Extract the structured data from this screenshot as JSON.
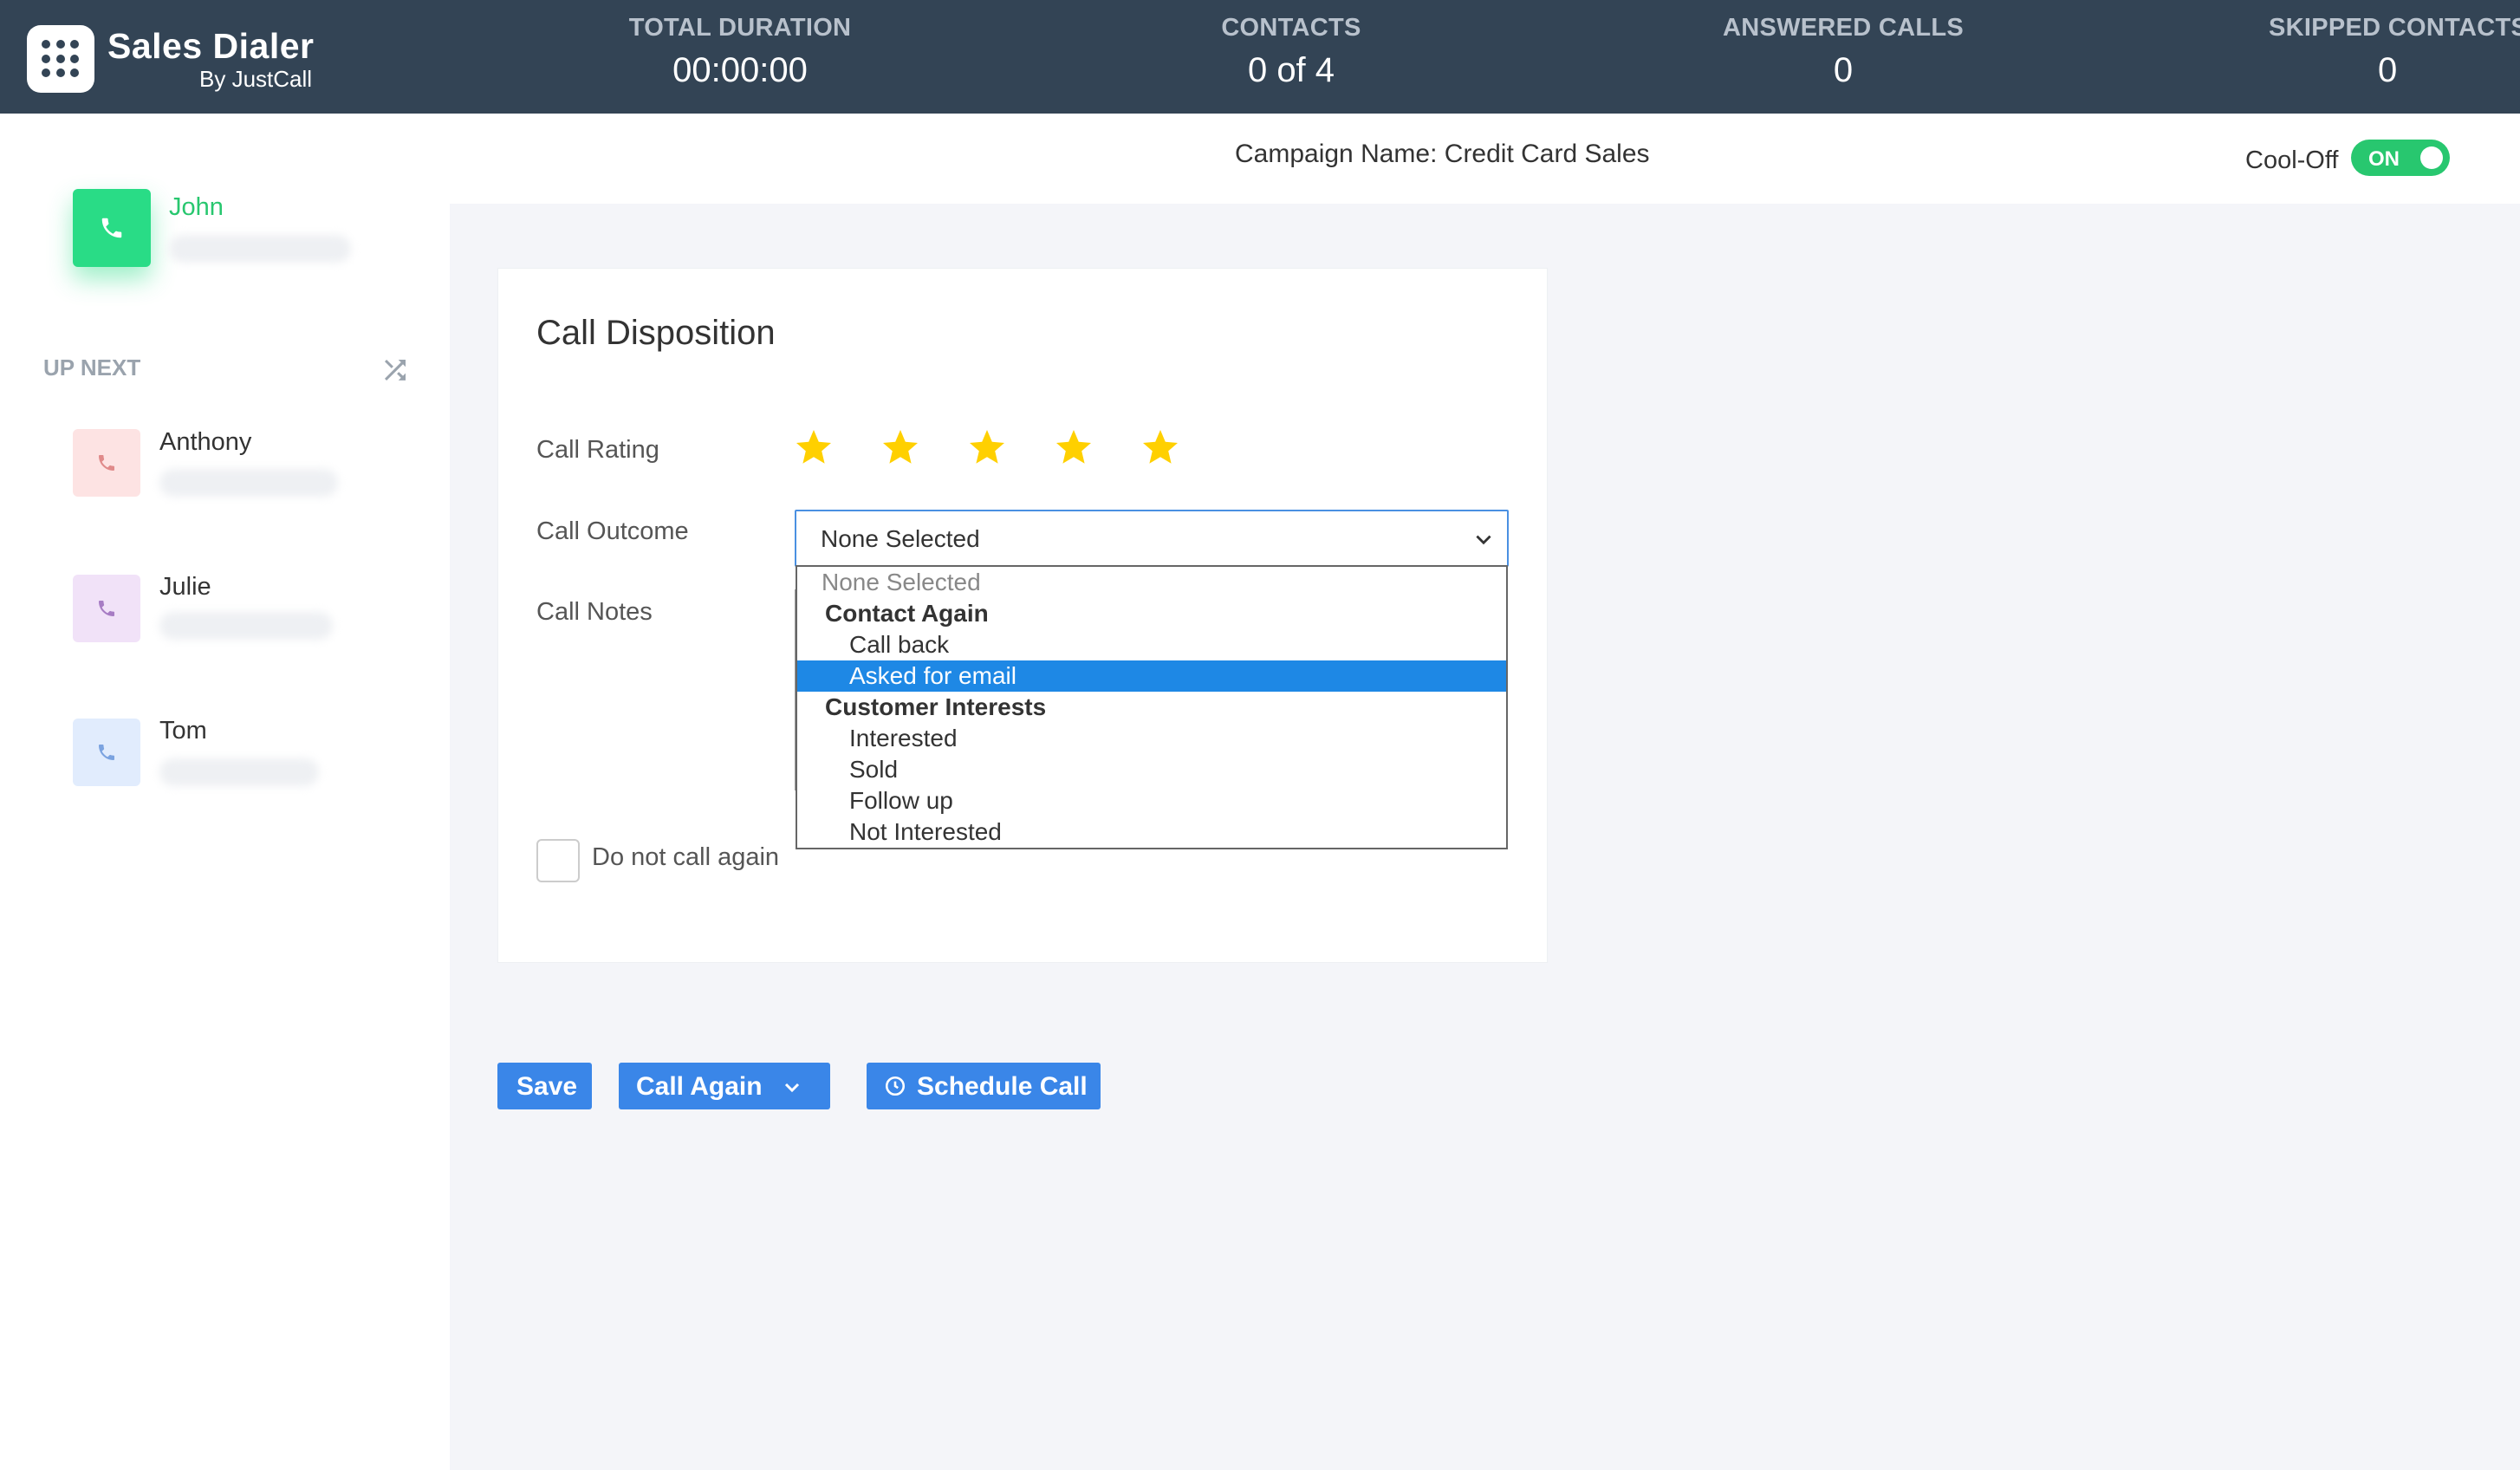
{
  "header": {
    "brand_name": "Sales Dialer",
    "brand_sub": "By JustCall",
    "stats": [
      {
        "label": "TOTAL DURATION",
        "value": "00:00:00"
      },
      {
        "label": "CONTACTS",
        "value": "0 of 4"
      },
      {
        "label": "ANSWERED CALLS",
        "value": "0"
      },
      {
        "label": "SKIPPED CONTACTS",
        "value": "0"
      }
    ]
  },
  "sidebar": {
    "current_contact": "John",
    "up_next_label": "UP NEXT",
    "up_next": [
      {
        "name": "Anthony",
        "color": "#fde3e3",
        "icon_color": "#e08a8a"
      },
      {
        "name": "Julie",
        "color": "#f1e2f8",
        "icon_color": "#a77cc4"
      },
      {
        "name": "Tom",
        "color": "#e1ecfd",
        "icon_color": "#7ba3e0"
      }
    ]
  },
  "campaign": {
    "name": "Campaign Name: Credit Card Sales",
    "cooloff_label": "Cool-Off",
    "cooloff_state": "ON"
  },
  "disposition": {
    "title": "Call Disposition",
    "rating_label": "Call Rating",
    "rating": 5,
    "rating_max": 5,
    "outcome_label": "Call Outcome",
    "outcome_value": "None Selected",
    "notes_label": "Call Notes",
    "dnc_label": "Do not call again",
    "options": [
      {
        "type": "placeholder",
        "label": "None Selected"
      },
      {
        "type": "group",
        "label": "Contact Again"
      },
      {
        "type": "item",
        "label": "Call back"
      },
      {
        "type": "item",
        "label": "Asked for email",
        "selected": true
      },
      {
        "type": "group",
        "label": "Customer Interests"
      },
      {
        "type": "item",
        "label": "Interested"
      },
      {
        "type": "item",
        "label": "Sold"
      },
      {
        "type": "item",
        "label": "Follow up"
      },
      {
        "type": "item",
        "label": "Not Interested"
      }
    ]
  },
  "actions": {
    "save": "Save",
    "call_again": "Call Again",
    "schedule": "Schedule Call"
  },
  "colors": {
    "header_bg": "#334455",
    "accent_green": "#28c76f",
    "button_blue": "#3a86e8",
    "star": "#ffd000",
    "selected_option": "#1e88e5"
  }
}
